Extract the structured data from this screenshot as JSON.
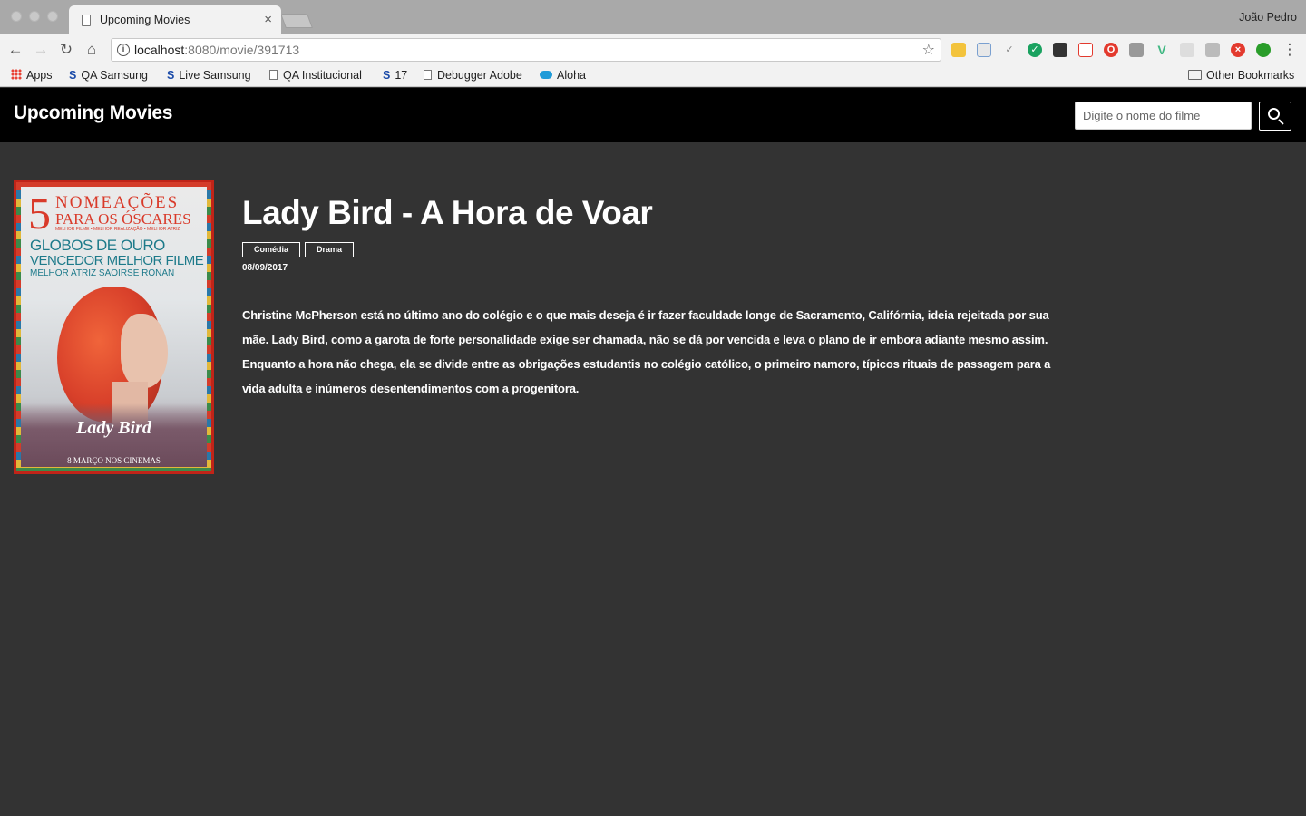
{
  "browser": {
    "tab_title": "Upcoming Movies",
    "tab_close": "×",
    "user_name": "João Pedro",
    "url_host": "localhost",
    "url_rest": ":8080/movie/391713",
    "bookmarks": [
      {
        "label": "Apps"
      },
      {
        "label": "QA Samsung",
        "icon": "S"
      },
      {
        "label": "Live Samsung",
        "icon": "S"
      },
      {
        "label": "QA Institucional"
      },
      {
        "label": "17",
        "icon": "S"
      },
      {
        "label": "Debugger Adobe"
      },
      {
        "label": "Aloha"
      }
    ],
    "other_bookmarks": "Other Bookmarks",
    "extension_icons": [
      "flag-icon",
      "window-icon",
      "check-icon",
      "share-icon",
      "tabs-icon",
      "pocket-icon",
      "opera-icon",
      "camera-icon",
      "vue-icon",
      "reload-icon",
      "square-icon",
      "block-icon",
      "green-circle-icon"
    ],
    "accent_colors": {
      "extension_green": "#1aa260",
      "extension_red": "#e33a2e",
      "vue": "#41b883"
    }
  },
  "app": {
    "brand": "Upcoming Movies",
    "search": {
      "placeholder": "Digite o nome do filme",
      "value": ""
    }
  },
  "movie": {
    "title": "Lady Bird - A Hora de Voar",
    "genres": [
      "Comédia",
      "Drama"
    ],
    "release_date": "08/09/2017",
    "overview": "Christine McPherson está no último ano do colégio e o que mais deseja é ir fazer faculdade longe de Sacramento, Califórnia, ideia rejeitada por sua mãe. Lady Bird, como a garota de forte personalidade exige ser chamada, não se dá por vencida e leva o plano de ir embora adiante mesmo assim. Enquanto a hora não chega, ela se divide entre as obrigações estudantis no colégio católico, o primeiro namoro, típicos rituais de passagem para a vida adulta e inúmeros desentendimentos com a progenitora.",
    "poster": {
      "five": "5",
      "nomeacoes": "NOMEAÇÕES",
      "para_os_oscares": "PARA OS ÓSCARES",
      "small_line": "MELHOR FILME • MELHOR REALIZAÇÃO • MELHOR ATRIZ",
      "globos_line1": "GLOBOS DE OURO",
      "globos_line2": "VENCEDOR MELHOR FILME",
      "globos_line3": "MELHOR ATRIZ   SAOIRSE RONAN",
      "logo": "Lady Bird",
      "date": "8 MARÇO NOS CINEMAS"
    }
  }
}
